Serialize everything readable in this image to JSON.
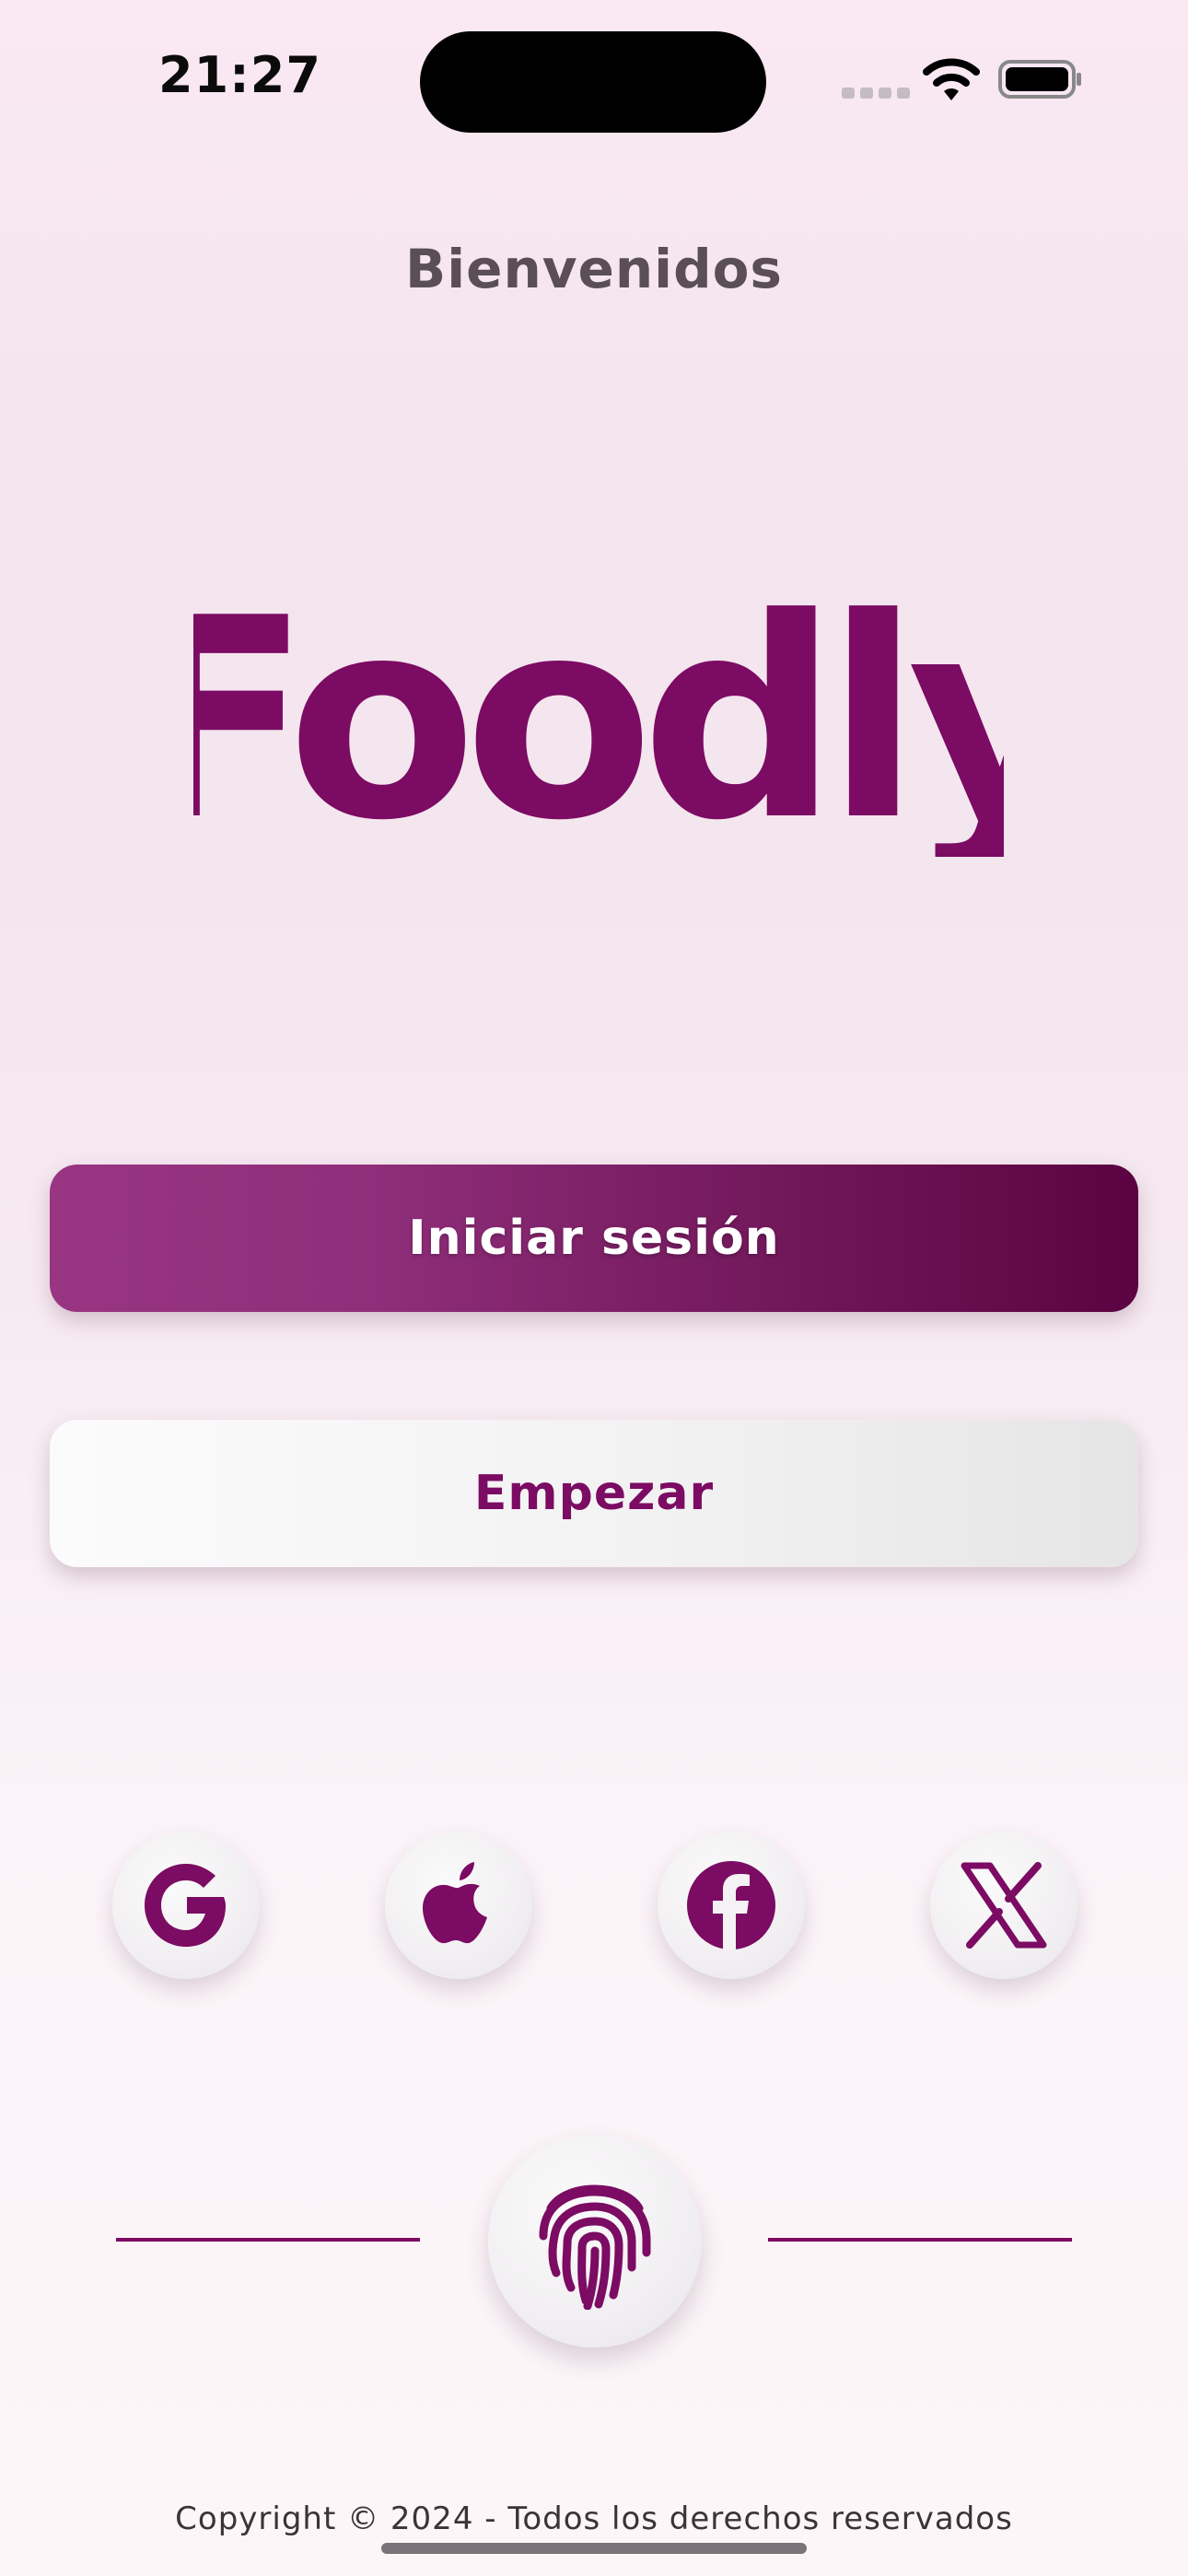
{
  "status_bar": {
    "time": "21:27",
    "icons": [
      "signal-icon",
      "wifi-icon",
      "battery-icon"
    ]
  },
  "welcome_title": "Bienvenidos",
  "logo_text": "Foodly",
  "buttons": {
    "login": "Iniciar sesión",
    "start": "Empezar"
  },
  "social_logins": [
    {
      "name": "Google",
      "icon": "google-icon"
    },
    {
      "name": "Apple",
      "icon": "apple-icon"
    },
    {
      "name": "Facebook",
      "icon": "facebook-icon"
    },
    {
      "name": "X",
      "icon": "x-icon"
    }
  ],
  "biometric": {
    "icon": "fingerprint-icon"
  },
  "footer": {
    "copyright": "Copyright © 2024 - Todos los derechos reservados"
  },
  "colors": {
    "brand": "#7b0b63",
    "brand_light": "#993583",
    "brand_dark": "#5b0342",
    "text_muted": "#5a4f57"
  }
}
